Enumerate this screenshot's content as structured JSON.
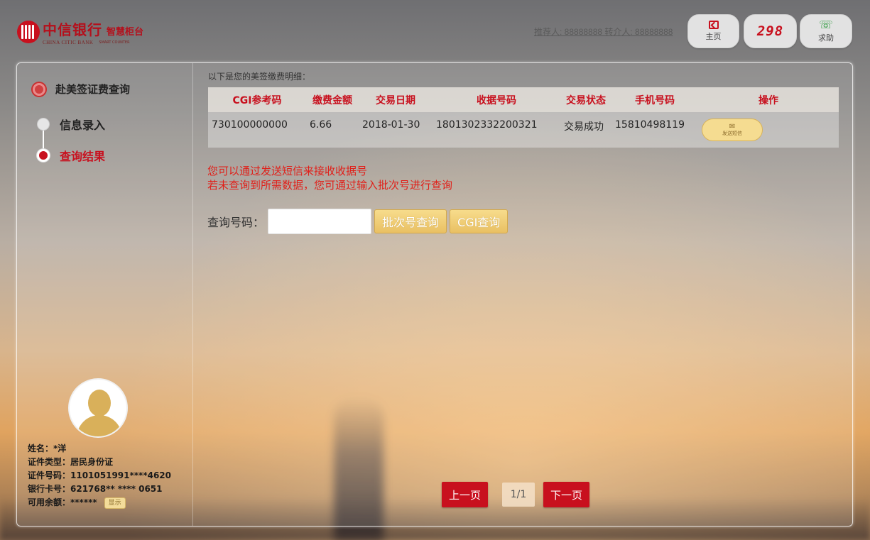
{
  "header": {
    "brand_cn": "中信银行",
    "brand_sub": "智慧柜台",
    "brand_en": "CHINA CITIC BANK",
    "brand_en_sub": "SMART COUNTER",
    "referrer": "推荐人: 88888888 转介人: 88888888",
    "home_label": "主页",
    "timer": "298",
    "help_label": "求助"
  },
  "sidebar": {
    "title": "赴美签证费查询",
    "steps": [
      {
        "label": "信息录入",
        "active": false
      },
      {
        "label": "查询结果",
        "active": true
      }
    ],
    "customer": {
      "name": "姓名：*洋",
      "id_type": "证件类型：居民身份证",
      "id_number": "证件号码：1101051991****4620",
      "card_number": "银行卡号：621768** **** 0651",
      "balance": "可用余额：******",
      "show_label": "显示"
    }
  },
  "main": {
    "intro": "以下是您的美签缴费明细：",
    "table": {
      "headers": [
        "CGI参考码",
        "缴费金额",
        "交易日期",
        "收据号码",
        "交易状态",
        "手机号码",
        "操作"
      ],
      "rows": [
        {
          "cgi": "730100000000",
          "amount": "6.66",
          "date": "2018-01-30",
          "receipt": "1801302332200321",
          "status": "交易成功",
          "phone": "15810498119",
          "action": "发送短信"
        }
      ]
    },
    "notice_line1": "您可以通过发送短信来接收收据号",
    "notice_line2": "若未查询到所需数据，您可通过输入批次号进行查询",
    "query_label": "查询号码：",
    "query_value": "",
    "batch_query_label": "批次号查询",
    "cgi_query_label": "CGI查询"
  },
  "pager": {
    "prev_label": "上一页",
    "page_indicator": "1/1",
    "next_label": "下一页"
  },
  "colors": {
    "brand_red": "#c8101e",
    "notice_red": "#e0201a",
    "gold": "#f5dc91"
  }
}
